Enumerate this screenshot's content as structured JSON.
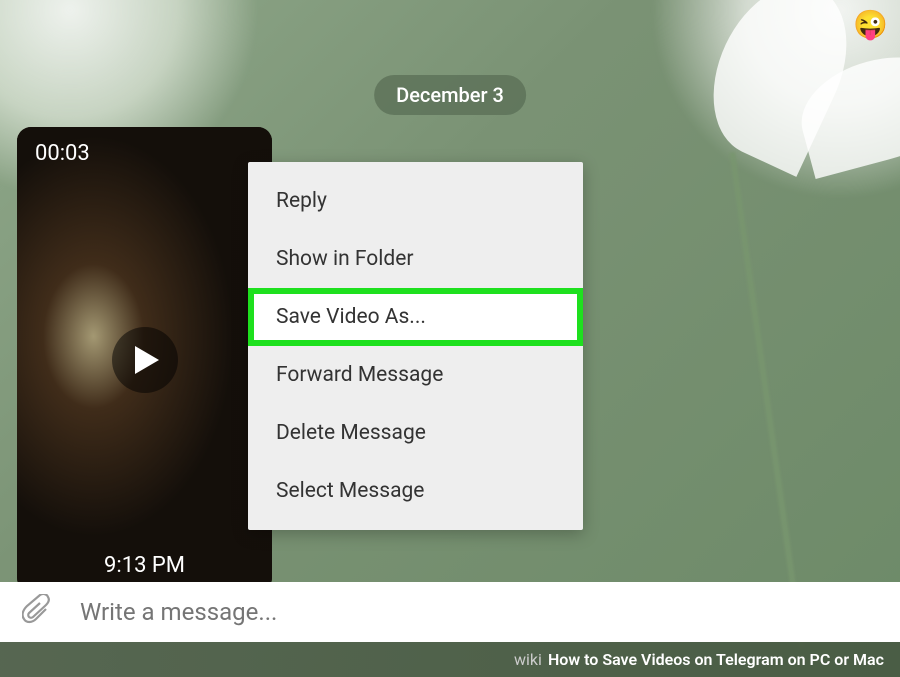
{
  "chat": {
    "date_divider": "December 3",
    "emoji": "😜"
  },
  "video": {
    "duration": "00:03",
    "timestamp": "9:13 PM"
  },
  "context_menu": {
    "items": [
      {
        "label": "Reply",
        "highlighted": false
      },
      {
        "label": "Show in Folder",
        "highlighted": false
      },
      {
        "label": "Save Video As...",
        "highlighted": true
      },
      {
        "label": "Forward Message",
        "highlighted": false
      },
      {
        "label": "Delete Message",
        "highlighted": false
      },
      {
        "label": "Select Message",
        "highlighted": false
      }
    ]
  },
  "input": {
    "placeholder": "Write a message..."
  },
  "banner": {
    "brand": "wiki",
    "title": "How to Save Videos on Telegram on PC or Mac"
  }
}
